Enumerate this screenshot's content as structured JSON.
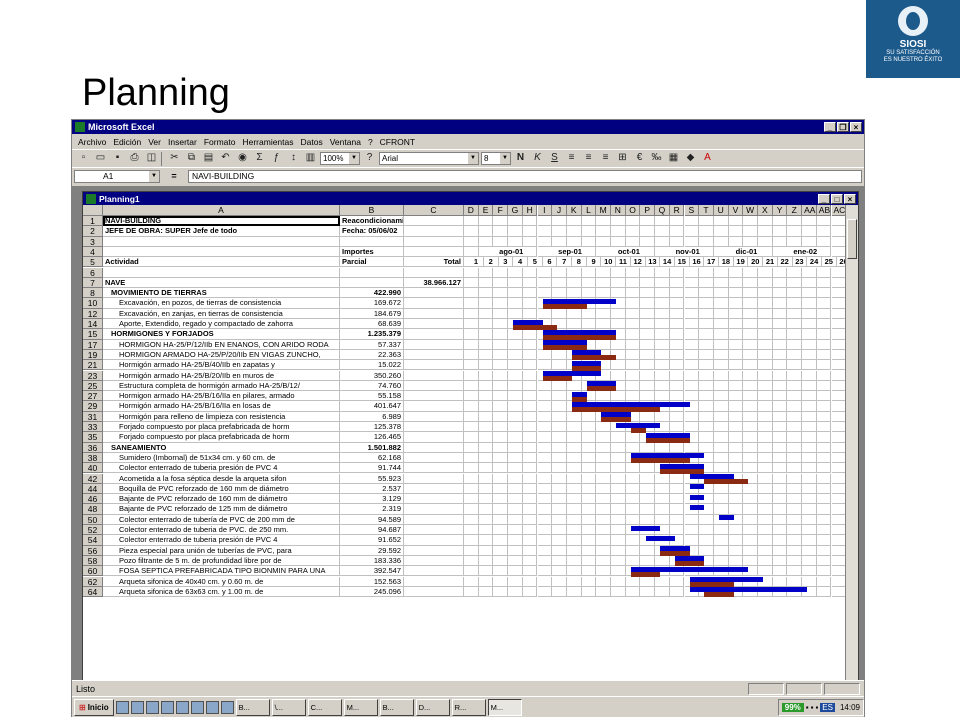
{
  "slide": {
    "title": "Planning",
    "logo": {
      "brand": "SIOSI",
      "tagline1": "SU SATISFACCIÓN",
      "tagline2": "ES NUESTRO ÉXITO"
    }
  },
  "app": {
    "title": "Microsoft Excel",
    "menu": [
      "Archivo",
      "Edición",
      "Ver",
      "Insertar",
      "Formato",
      "Herramientas",
      "Datos",
      "Ventana",
      "?",
      "CFRONT"
    ],
    "zoom": "100%",
    "font": "Arial",
    "font_size": "8",
    "namebox": "A1",
    "equals": "=",
    "formula": "NAVI-BUILDING",
    "status": "Listo"
  },
  "workbook": {
    "title": "Planning1",
    "columns": [
      "A",
      "B",
      "C",
      "D",
      "E",
      "F",
      "G",
      "H",
      "I",
      "J",
      "K",
      "L",
      "M",
      "N",
      "O",
      "P",
      "Q",
      "R",
      "S",
      "T",
      "U",
      "V",
      "W",
      "X",
      "Y",
      "Z",
      "AA",
      "AB",
      "AC"
    ],
    "months": [
      "ago-01",
      "sep-01",
      "oct-01",
      "nov-01",
      "dic-01",
      "ene-02"
    ],
    "weeks": [
      "1",
      "2",
      "3",
      "4",
      "5",
      "6",
      "7",
      "8",
      "9",
      "10",
      "11",
      "12",
      "13",
      "14",
      "15",
      "16",
      "17",
      "18",
      "19",
      "20",
      "21",
      "22",
      "23",
      "24",
      "25",
      "26"
    ],
    "rows": [
      {
        "n": "1",
        "a": "NAVI-BUILDING",
        "b": "Reacondicionamiento P.I. El Pino",
        "c": "",
        "style": "bold"
      },
      {
        "n": "2",
        "a": "JEFE DE OBRA: SUPER Jefe de todo",
        "b": "Fecha: 05/06/02",
        "c": "",
        "style": "bold"
      },
      {
        "n": "3",
        "a": "",
        "b": "",
        "c": "",
        "style": ""
      },
      {
        "n": "4",
        "a": "",
        "b": "Importes",
        "c": "",
        "style": "bold"
      },
      {
        "n": "5",
        "a": "Actividad",
        "b": "Parcial",
        "c": "Total",
        "style": "bold"
      },
      {
        "n": "6",
        "a": "",
        "b": "",
        "c": "",
        "style": ""
      },
      {
        "n": "7",
        "a": "NAVE",
        "b": "",
        "c": "38.966.127",
        "style": "bold"
      },
      {
        "n": "8",
        "a": "MOVIMIENTO DE TIERRAS",
        "b": "422.990",
        "c": "",
        "style": "bold"
      },
      {
        "n": "10",
        "a": "Excavación, en pozos, de tierras de consistencia",
        "b": "169.672",
        "c": "",
        "style": ""
      },
      {
        "n": "12",
        "a": "Excavación, en zanjas, en tierras de consistencia",
        "b": "184.679",
        "c": "",
        "style": ""
      },
      {
        "n": "14",
        "a": "Aporte, Extendido, regado y compactado de zahorra",
        "b": "68.639",
        "c": "",
        "style": ""
      },
      {
        "n": "15",
        "a": "HORMIGONES Y FORJADOS",
        "b": "1.235.379",
        "c": "",
        "style": "bold"
      },
      {
        "n": "17",
        "a": "HORMIGON HA-25/P/12/IIb EN ENANOS, CON ARIDO RODA",
        "b": "57.337",
        "c": "",
        "style": ""
      },
      {
        "n": "19",
        "a": "HORMIGON ARMADO HA-25/P/20/IIb EN VIGAS ZUNCHO,",
        "b": "22.363",
        "c": "",
        "style": ""
      },
      {
        "n": "21",
        "a": "Hormigón armado HA-25/B/40/IIb en zapatas y",
        "b": "15.022",
        "c": "",
        "style": ""
      },
      {
        "n": "23",
        "a": "Hormigón armado HA-25/B/20/IIb en muros de",
        "b": "350.260",
        "c": "",
        "style": ""
      },
      {
        "n": "25",
        "a": "Estructura completa de hormigón armado HA-25/B/12/",
        "b": "74.760",
        "c": "",
        "style": ""
      },
      {
        "n": "27",
        "a": "Hormigon armado HA-25/B/16/IIa en pilares, armado",
        "b": "55.158",
        "c": "",
        "style": ""
      },
      {
        "n": "29",
        "a": "Hormigón armado HA-25/B/16/IIa en losas de",
        "b": "401.647",
        "c": "",
        "style": ""
      },
      {
        "n": "31",
        "a": "Hormigón para relleno de limpieza con resistencia",
        "b": "6.989",
        "c": "",
        "style": ""
      },
      {
        "n": "33",
        "a": "Forjado compuesto por placa prefabricada de horm",
        "b": "125.378",
        "c": "",
        "style": ""
      },
      {
        "n": "35",
        "a": "Forjado compuesto por placa prefabricada de horm",
        "b": "126.465",
        "c": "",
        "style": ""
      },
      {
        "n": "36",
        "a": "SANEAMIENTO",
        "b": "1.501.882",
        "c": "",
        "style": "bold"
      },
      {
        "n": "38",
        "a": "Sumidero (Imbornal) de 51x34 cm. y 60 cm. de",
        "b": "62.168",
        "c": "",
        "style": ""
      },
      {
        "n": "40",
        "a": "Colector enterrado de tuberia presión de PVC 4",
        "b": "91.744",
        "c": "",
        "style": ""
      },
      {
        "n": "42",
        "a": "Acometida a la fosa séptica desde la arqueta sifon",
        "b": "55.923",
        "c": "",
        "style": ""
      },
      {
        "n": "44",
        "a": "Boquilla de PVC reforzado de 160 mm de diámetro",
        "b": "2.537",
        "c": "",
        "style": ""
      },
      {
        "n": "46",
        "a": "Bajante de PVC reforzado de 160 mm de diámetro",
        "b": "3.129",
        "c": "",
        "style": ""
      },
      {
        "n": "48",
        "a": "Bajante de PVC reforzado de 125 mm de diámetro",
        "b": "2.319",
        "c": "",
        "style": ""
      },
      {
        "n": "50",
        "a": "Colector enterrado de tubería de PVC de 200 mm de",
        "b": "94.589",
        "c": "",
        "style": ""
      },
      {
        "n": "52",
        "a": "Colector enterrado de tuberia de PVC. de 250 mm.",
        "b": "94.687",
        "c": "",
        "style": ""
      },
      {
        "n": "54",
        "a": "Colector enterrado de tuberia presión de PVC 4",
        "b": "91.652",
        "c": "",
        "style": ""
      },
      {
        "n": "56",
        "a": "Pieza especial para unión de tuberías de PVC, para",
        "b": "29.592",
        "c": "",
        "style": ""
      },
      {
        "n": "58",
        "a": "Pozo filtrante de 5 m. de profundidad libre por de",
        "b": "183.336",
        "c": "",
        "style": ""
      },
      {
        "n": "60",
        "a": "FOSA SEPTICA PREFABRICADA TIPO BIONMIN PARA UNA",
        "b": "392.547",
        "c": "",
        "style": ""
      },
      {
        "n": "62",
        "a": "Arqueta sifonica de 40x40 cm. y 0.60 m. de",
        "b": "152.563",
        "c": "",
        "style": ""
      },
      {
        "n": "64",
        "a": "Arqueta sifonica de 63x63 cm. y 1.00 m. de",
        "b": "245.096",
        "c": "",
        "style": ""
      }
    ],
    "bars": [
      {
        "row": 8,
        "start": 5,
        "len": 5,
        "color": "blue"
      },
      {
        "row": 8,
        "start": 5,
        "len": 3,
        "color": "brown"
      },
      {
        "row": 10,
        "start": 3,
        "len": 2,
        "color": "blue"
      },
      {
        "row": 10,
        "start": 3,
        "len": 3,
        "color": "brown"
      },
      {
        "row": 11,
        "start": 5,
        "len": 5,
        "color": "blue"
      },
      {
        "row": 11,
        "start": 5,
        "len": 5,
        "color": "brown"
      },
      {
        "row": 12,
        "start": 5,
        "len": 3,
        "color": "blue"
      },
      {
        "row": 12,
        "start": 5,
        "len": 3,
        "color": "brown"
      },
      {
        "row": 13,
        "start": 7,
        "len": 2,
        "color": "blue"
      },
      {
        "row": 13,
        "start": 7,
        "len": 3,
        "color": "brown"
      },
      {
        "row": 14,
        "start": 7,
        "len": 2,
        "color": "blue"
      },
      {
        "row": 14,
        "start": 7,
        "len": 2,
        "color": "brown"
      },
      {
        "row": 15,
        "start": 5,
        "len": 4,
        "color": "blue"
      },
      {
        "row": 15,
        "start": 5,
        "len": 2,
        "color": "brown"
      },
      {
        "row": 16,
        "start": 8,
        "len": 2,
        "color": "blue"
      },
      {
        "row": 16,
        "start": 8,
        "len": 2,
        "color": "brown"
      },
      {
        "row": 17,
        "start": 7,
        "len": 1,
        "color": "blue"
      },
      {
        "row": 17,
        "start": 7,
        "len": 1,
        "color": "brown"
      },
      {
        "row": 18,
        "start": 7,
        "len": 8,
        "color": "blue"
      },
      {
        "row": 18,
        "start": 7,
        "len": 6,
        "color": "brown"
      },
      {
        "row": 19,
        "start": 9,
        "len": 2,
        "color": "blue"
      },
      {
        "row": 19,
        "start": 9,
        "len": 2,
        "color": "brown"
      },
      {
        "row": 20,
        "start": 10,
        "len": 3,
        "color": "blue"
      },
      {
        "row": 20,
        "start": 11,
        "len": 1,
        "color": "brown"
      },
      {
        "row": 21,
        "start": 12,
        "len": 3,
        "color": "blue"
      },
      {
        "row": 21,
        "start": 12,
        "len": 3,
        "color": "brown"
      },
      {
        "row": 23,
        "start": 11,
        "len": 5,
        "color": "blue"
      },
      {
        "row": 23,
        "start": 11,
        "len": 4,
        "color": "brown"
      },
      {
        "row": 24,
        "start": 13,
        "len": 3,
        "color": "blue"
      },
      {
        "row": 24,
        "start": 13,
        "len": 3,
        "color": "brown"
      },
      {
        "row": 25,
        "start": 15,
        "len": 3,
        "color": "blue"
      },
      {
        "row": 25,
        "start": 16,
        "len": 3,
        "color": "brown"
      },
      {
        "row": 26,
        "start": 15,
        "len": 1,
        "color": "blue"
      },
      {
        "row": 27,
        "start": 15,
        "len": 1,
        "color": "blue"
      },
      {
        "row": 28,
        "start": 15,
        "len": 1,
        "color": "blue"
      },
      {
        "row": 29,
        "start": 17,
        "len": 1,
        "color": "blue"
      },
      {
        "row": 30,
        "start": 11,
        "len": 2,
        "color": "blue"
      },
      {
        "row": 31,
        "start": 12,
        "len": 2,
        "color": "blue"
      },
      {
        "row": 32,
        "start": 13,
        "len": 2,
        "color": "blue"
      },
      {
        "row": 32,
        "start": 13,
        "len": 2,
        "color": "brown"
      },
      {
        "row": 33,
        "start": 14,
        "len": 2,
        "color": "blue"
      },
      {
        "row": 33,
        "start": 14,
        "len": 2,
        "color": "brown"
      },
      {
        "row": 34,
        "start": 11,
        "len": 8,
        "color": "blue"
      },
      {
        "row": 34,
        "start": 11,
        "len": 2,
        "color": "brown"
      },
      {
        "row": 35,
        "start": 15,
        "len": 5,
        "color": "blue"
      },
      {
        "row": 35,
        "start": 15,
        "len": 3,
        "color": "brown"
      },
      {
        "row": 36,
        "start": 15,
        "len": 8,
        "color": "blue"
      },
      {
        "row": 36,
        "start": 16,
        "len": 2,
        "color": "brown"
      }
    ]
  },
  "taskbar": {
    "start": "Inicio",
    "tasks": [
      "B...",
      "\\...",
      "C...",
      "M...",
      "B...",
      "D...",
      "R...",
      "M..."
    ],
    "battery": "99%",
    "lang": "ES",
    "clock": "14:09"
  }
}
